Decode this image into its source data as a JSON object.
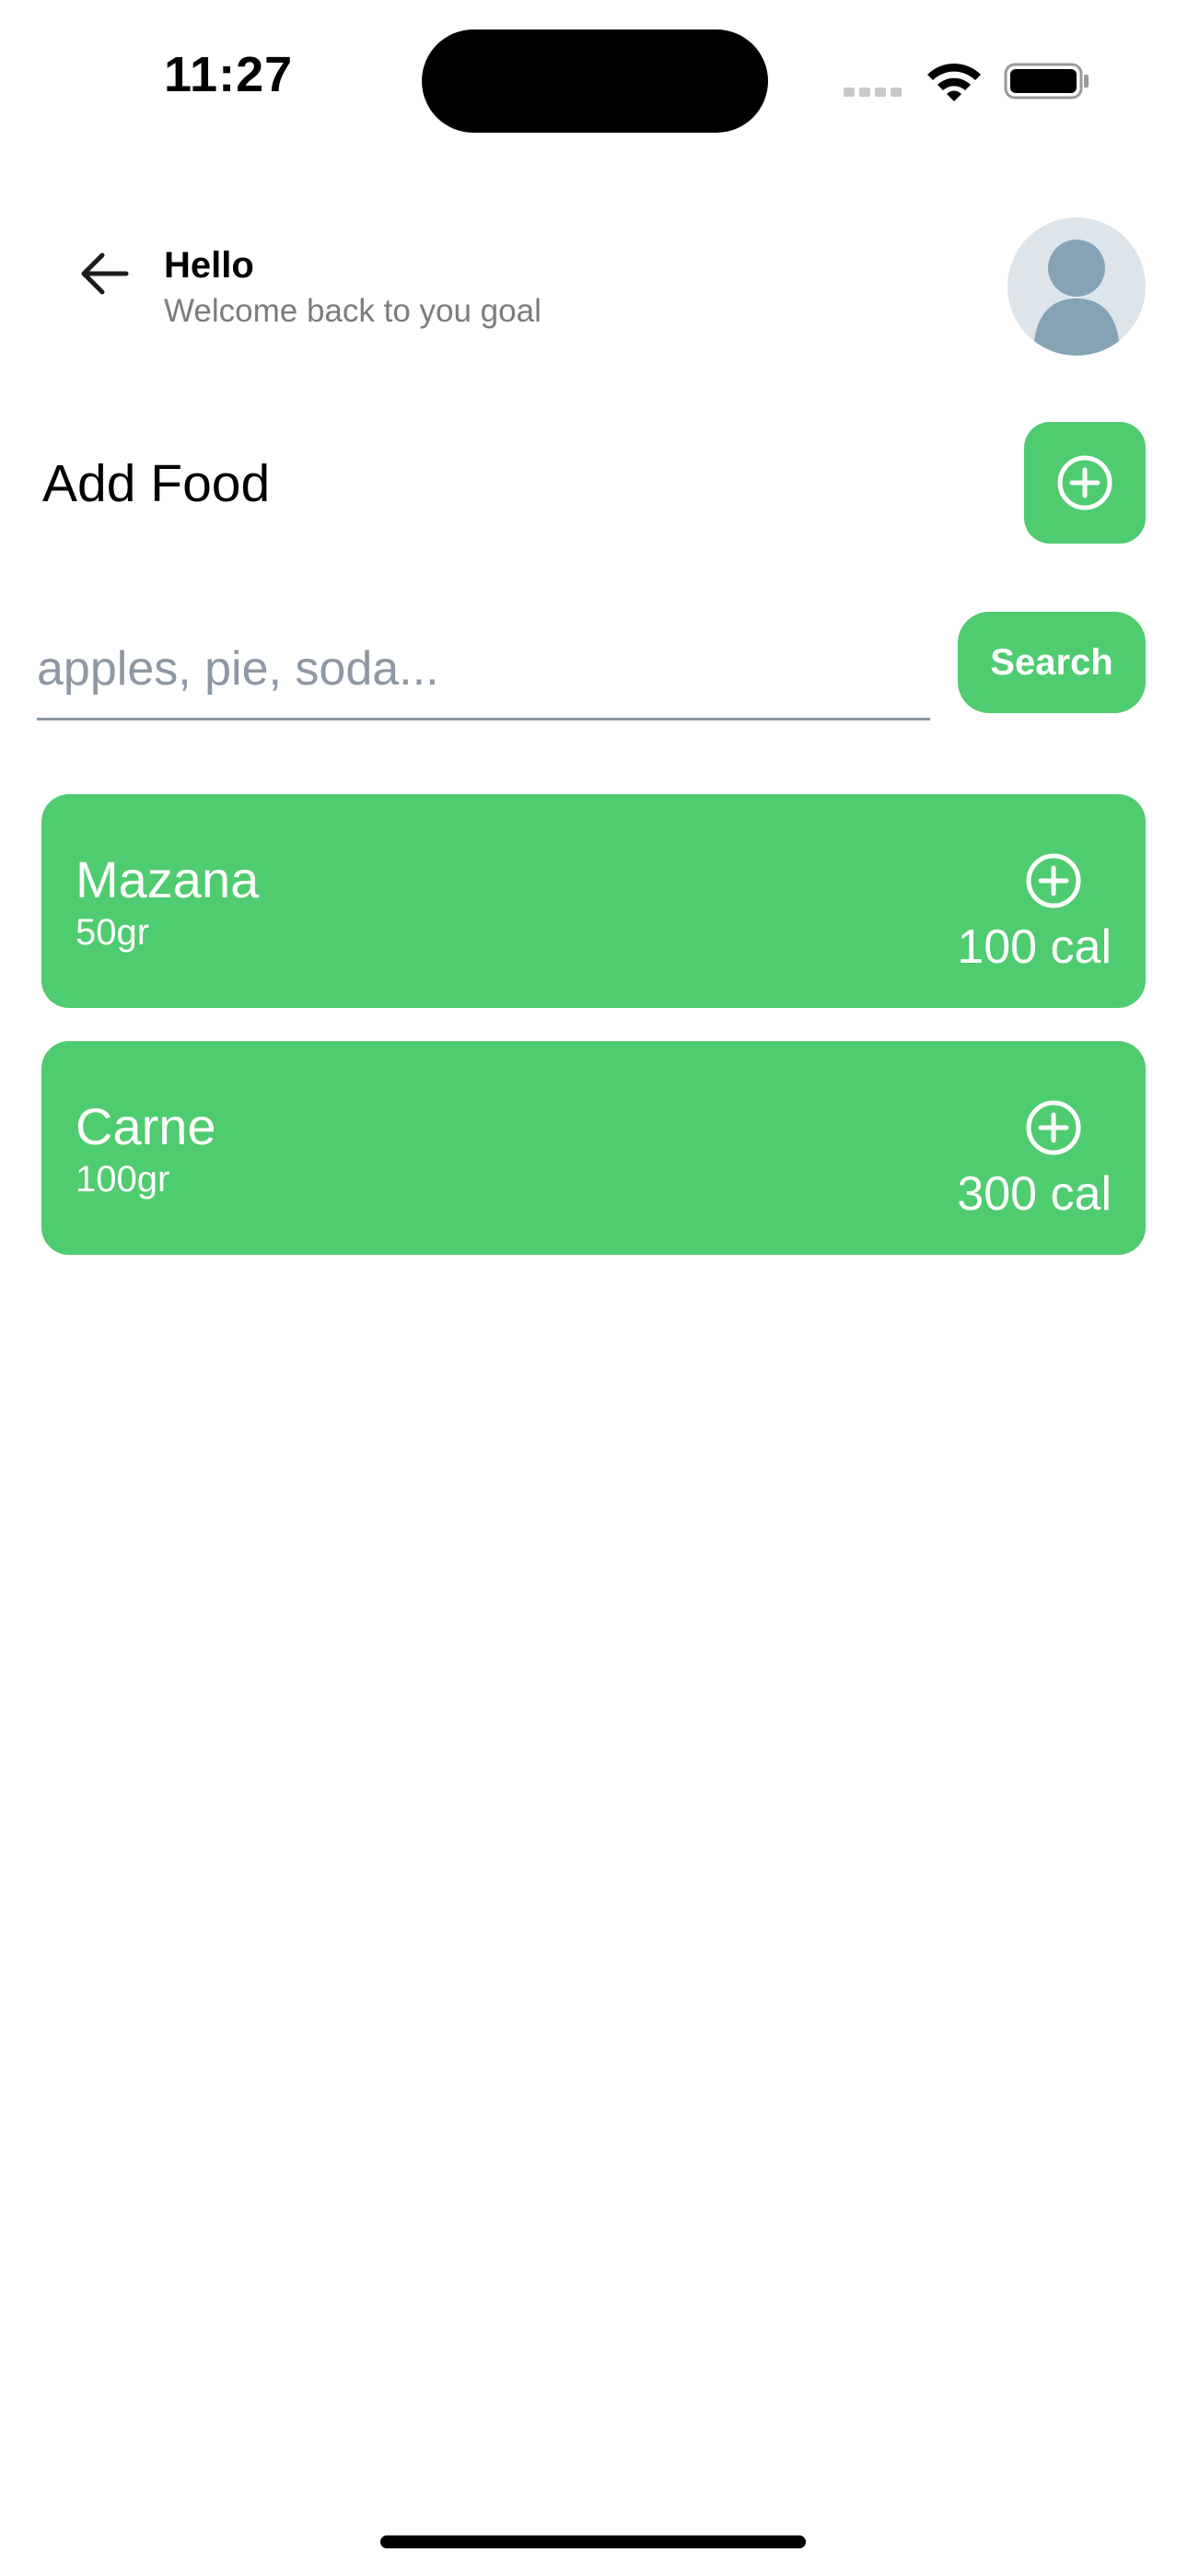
{
  "status_bar": {
    "time": "11:27"
  },
  "header": {
    "title": "Hello",
    "subtitle": "Welcome back to you goal"
  },
  "section": {
    "title": "Add Food"
  },
  "search": {
    "value": "",
    "placeholder": "apples, pie, soda...",
    "button_label": "Search"
  },
  "foods": [
    {
      "name": "Mazana",
      "weight": "50gr",
      "calories": "100 cal"
    },
    {
      "name": "Carne",
      "weight": "100gr",
      "calories": "300 cal"
    }
  ],
  "colors": {
    "accent": "#4fcb70",
    "avatar_bg": "#dde4ea",
    "avatar_figure": "#86a3b6"
  },
  "icons": {
    "back": "arrow-left-icon",
    "avatar": "user-avatar-icon",
    "add": "plus-circle-icon"
  }
}
